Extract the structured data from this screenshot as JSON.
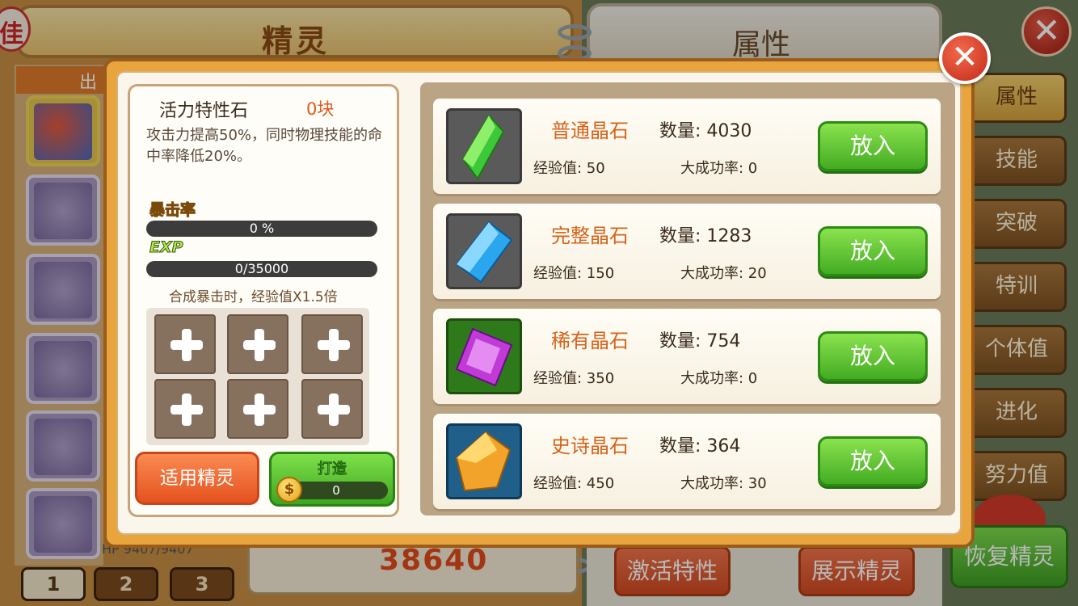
{
  "background": {
    "corner_badge": "佳",
    "left_title": "精灵",
    "right_title": "属性",
    "sidebar_header": "出",
    "hp_text": "HP 9407/9407",
    "page_tabs": [
      "1",
      "2",
      "3"
    ],
    "power_value": "38640",
    "activate_trait_button": "激活特性",
    "show_pokemon_button": "展示精灵",
    "right_tabs": [
      "属性",
      "技能",
      "突破",
      "特训",
      "个体值",
      "进化",
      "努力值"
    ],
    "restore_button": "恢复精灵"
  },
  "modal": {
    "stone": {
      "name": "活力特性石",
      "count": "0块",
      "description": "攻击力提高50%，同时物理技能的命中率降低20%。"
    },
    "crit_label": "暴击率",
    "crit_value": "0 %",
    "crit_rate_fraction": 0,
    "exp_label": "EXP",
    "exp_value": "0/35000",
    "exp_fraction": 0,
    "multiplier_note": "合成暴击时，经验值X1.5倍",
    "slot_count": 6,
    "apply_button": "适用精灵",
    "forge_button": "打造",
    "forge_cost": "0",
    "crystals": [
      {
        "name": "普通晶石",
        "qty": "数量: 4030",
        "exp": "经验值: 50",
        "rate": "大成功率: 0",
        "button": "放入",
        "color": "#3dc83a",
        "frame": "#4a4a4a",
        "icon": "green-crystal-icon"
      },
      {
        "name": "完整晶石",
        "qty": "数量: 1283",
        "exp": "经验值: 150",
        "rate": "大成功率: 20",
        "button": "放入",
        "color": "#2aa6ee",
        "frame": "#4a4a4a",
        "icon": "blue-crystal-icon"
      },
      {
        "name": "稀有晶石",
        "qty": "数量: 754",
        "exp": "经验值: 350",
        "rate": "大成功率: 0",
        "button": "放入",
        "color": "#c03ad6",
        "frame": "#2e7a1a",
        "icon": "purple-crystal-icon"
      },
      {
        "name": "史诗晶石",
        "qty": "数量: 364",
        "exp": "经验值: 450",
        "rate": "大成功率: 30",
        "button": "放入",
        "color": "#f2a42a",
        "frame": "#1f5f8a",
        "icon": "gold-crystal-icon"
      }
    ]
  }
}
